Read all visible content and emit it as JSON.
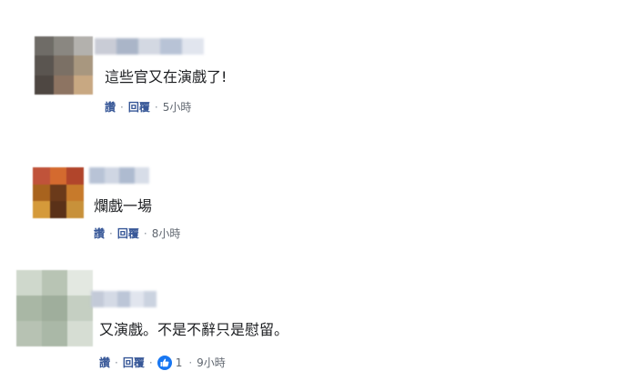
{
  "comments": [
    {
      "text": "這些官又在演戲了!",
      "like_label": "讚",
      "reply_label": "回覆",
      "separator": "·",
      "time": "5小時",
      "avatar_colors": [
        "#6f6c67",
        "#8a8781",
        "#b3b1ad",
        "#5a5550",
        "#7b7065",
        "#a8977f",
        "#4e4742",
        "#8d7462",
        "#c8a882"
      ],
      "name_blur_colors": [
        "#c9ccd6",
        "#aab5c8",
        "#d3d8e2",
        "#b8c3d6",
        "#e1e5ee"
      ]
    },
    {
      "text": "爛戲一場",
      "like_label": "讚",
      "reply_label": "回覆",
      "separator": "·",
      "time": "8小時",
      "avatar_colors": [
        "#c0533a",
        "#d46a2f",
        "#b1452b",
        "#a8631e",
        "#6b3a1a",
        "#c77a2b",
        "#d59a3a",
        "#5a3118",
        "#c8913a"
      ],
      "name_blur_colors": [
        "#b8c3d6",
        "#cfd6e3",
        "#aebbd0",
        "#d7dde8"
      ]
    },
    {
      "text": "又演戲。不是不辭只是慰留。",
      "like_label": "讚",
      "reply_label": "回覆",
      "separator": "·",
      "reaction_count": "1",
      "time": "9小時",
      "avatar_colors": [
        "#cfd8cc",
        "#b8c4b4",
        "#e3e8e1",
        "#a9b7a5",
        "#9fae9c",
        "#c5cfc2",
        "#b7c2b3",
        "#aab8a7",
        "#d6ddd3"
      ],
      "name_blur_colors": [
        "#c3cad8",
        "#d4dae5",
        "#bcc6d7",
        "#e1e5ee",
        "#cbd3e0"
      ]
    }
  ]
}
